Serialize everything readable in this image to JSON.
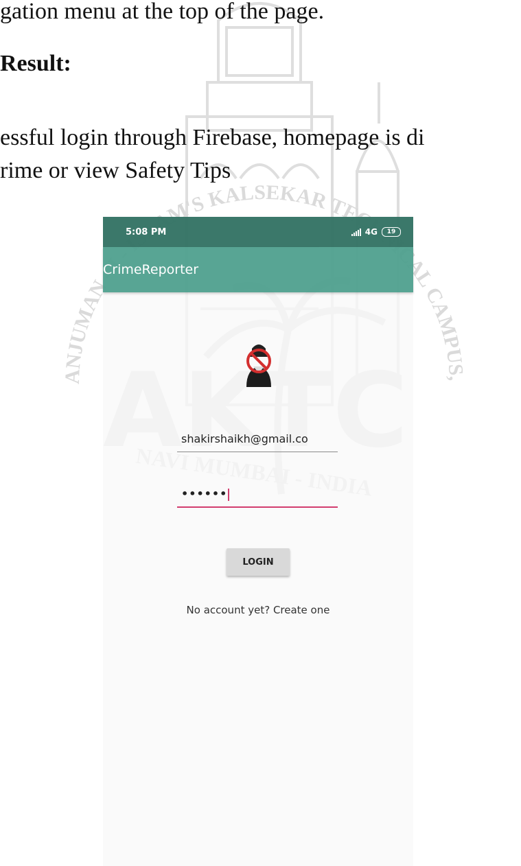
{
  "document": {
    "line1": "gation menu at the top of the page.",
    "line2_bold": "Result:",
    "line3": "essful login through Firebase, homepage is di",
    "line4": "rime or view Safety Tips"
  },
  "watermark": {
    "arc_text": "ANJUMAN - I - ISLAM'S KALSEKAR TECHNICAL CAMPUS, NEW PANVEL",
    "bottom_text": "NAVI MUMBAI - INDIA",
    "logo_letters": "AKTC"
  },
  "phone": {
    "status": {
      "time": "5:08 PM",
      "network": "4G",
      "battery": "19"
    },
    "app_title": "CrimeReporter",
    "email_value": "shakirshaikh@gmail.co",
    "password_value": "••••••",
    "login_label": "LOGIN",
    "create_account_label": "No account yet? Create one",
    "logo_icon": "no-thief-icon"
  },
  "colors": {
    "status_bar": "#26695a",
    "app_bar": "#3c9682",
    "accent": "#d23c6e",
    "button": "#d9d9d9"
  }
}
